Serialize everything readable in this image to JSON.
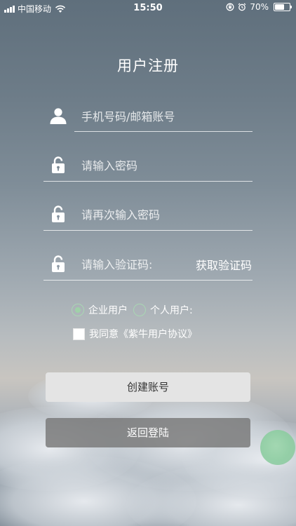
{
  "status_bar": {
    "carrier": "中国移动",
    "time": "15:50",
    "battery_text": "70%",
    "battery_level": 0.7,
    "icons": [
      "signal-icon",
      "wifi-icon",
      "orientation-lock-icon",
      "alarm-icon",
      "battery-icon"
    ]
  },
  "page": {
    "title": "用户注册"
  },
  "form": {
    "account_placeholder": "手机号码/邮箱账号",
    "password_placeholder": "请输入密码",
    "confirm_password_placeholder": "请再次输入密码",
    "code_placeholder": "请输入验证码:",
    "get_code_label": "获取验证码",
    "user_type": {
      "options": [
        "企业用户",
        "个人用户:"
      ],
      "selected": "企业用户"
    },
    "agreement_label": "我同意《紫牛用户协议》",
    "agreement_checked": false
  },
  "buttons": {
    "create_label": "创建账号",
    "back_label": "返回登陆"
  },
  "colors": {
    "radio_accent": "#9fd1a8",
    "float_ball": "#a0d7af",
    "create_button_bg": "#e4e4e4",
    "back_button_bg": "#787878"
  }
}
